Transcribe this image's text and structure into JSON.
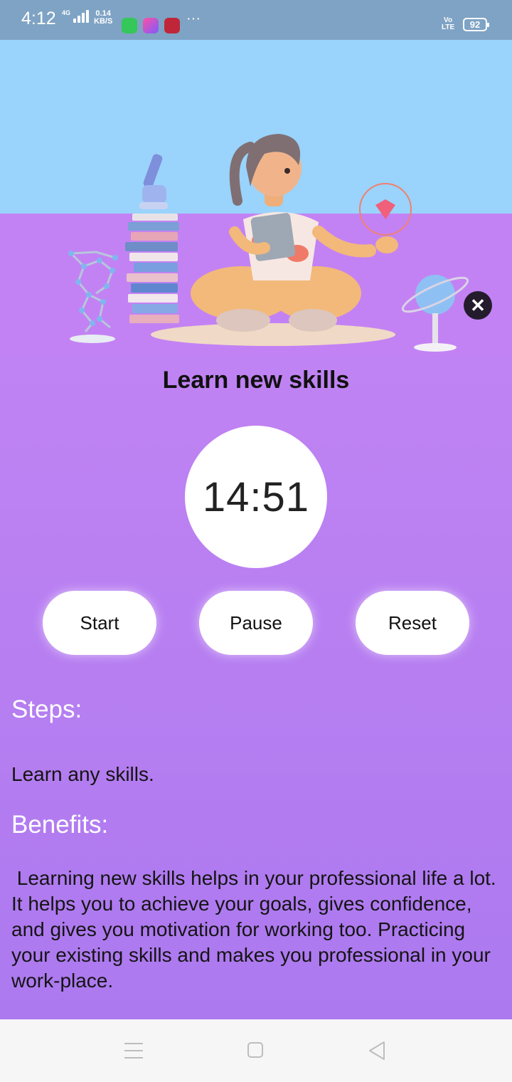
{
  "status_bar": {
    "time": "4:12",
    "network": "4G",
    "speed_value": "0.14",
    "speed_unit": "KB/S",
    "more": "···",
    "volte_top": "Vo",
    "volte_bottom": "LTE",
    "battery": "92"
  },
  "close_icon": "close-icon",
  "activity": {
    "title": "Learn new skills",
    "timer": "14:51"
  },
  "controls": {
    "start": "Start",
    "pause": "Pause",
    "reset": "Reset"
  },
  "steps": {
    "heading": "Steps:",
    "text": "Learn any skills."
  },
  "benefits": {
    "heading": "Benefits:",
    "text": " Learning new skills helps in your professional life a lot. It helps you to achieve your goals, gives confidence, and gives you motivation for working too. Practicing your existing skills and makes you professional in your work-place."
  },
  "colors": {
    "sky": "#9ad3fb",
    "accent_purple": "#c382f4",
    "status_bar": "#7fa3c4"
  }
}
